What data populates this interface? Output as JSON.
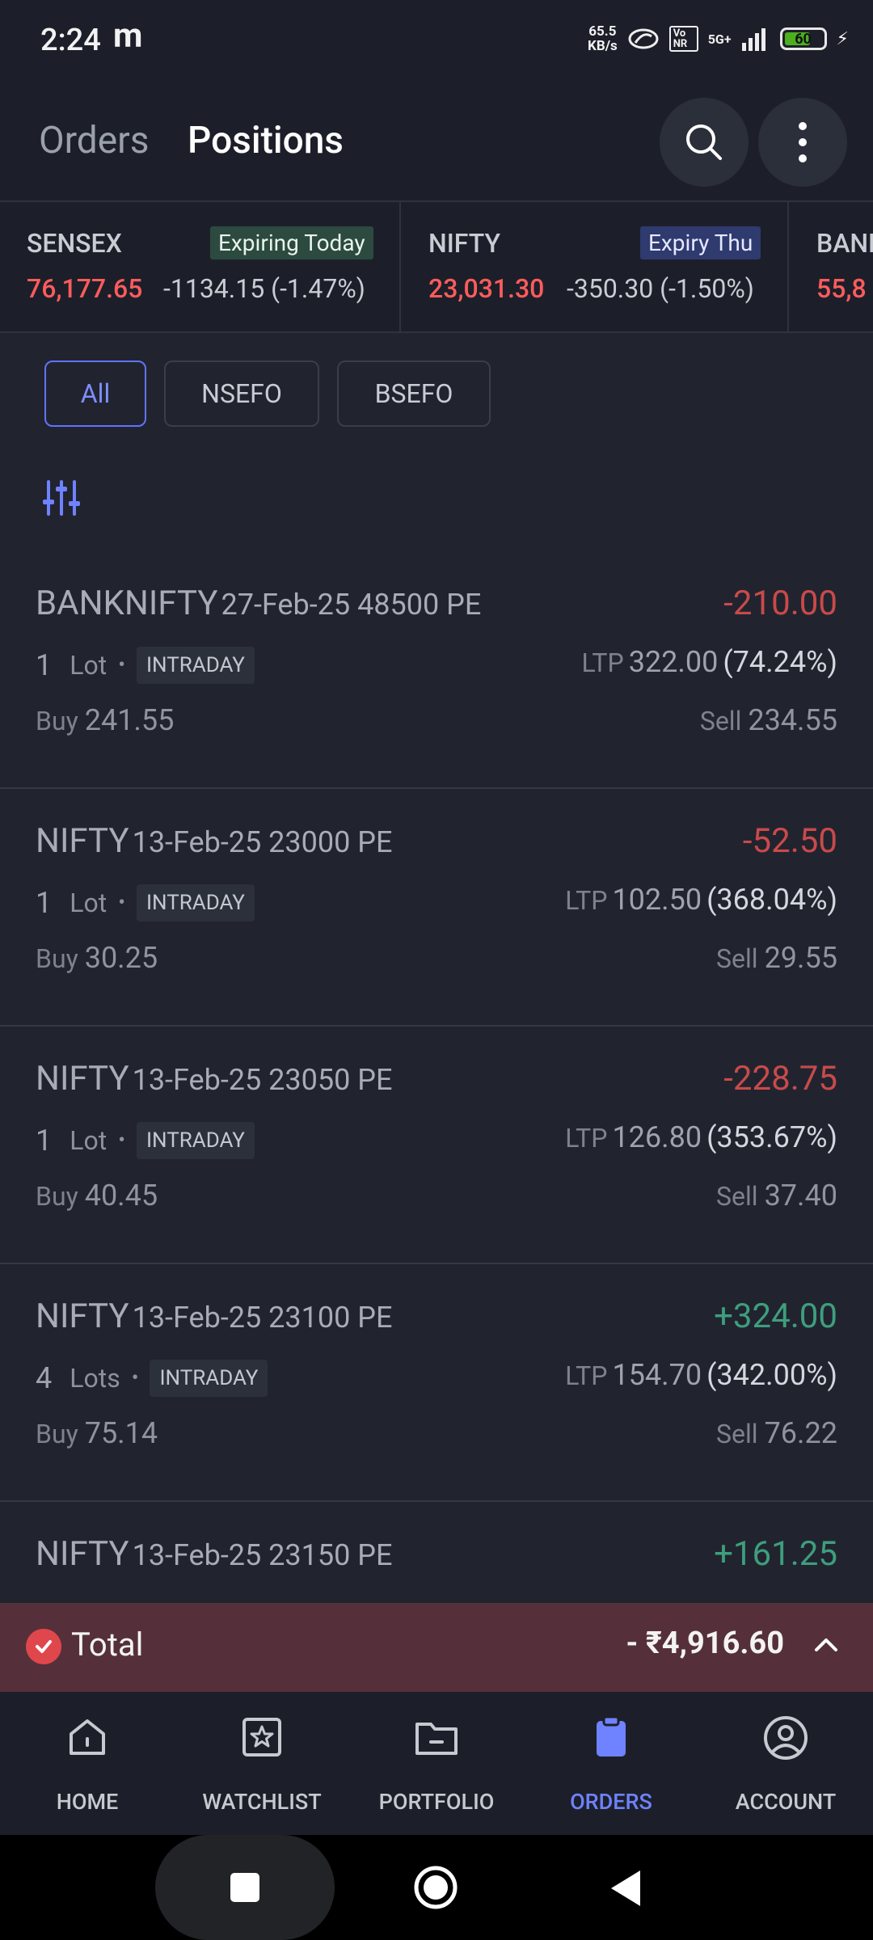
{
  "status_bar": {
    "time": "2:24",
    "app_glyph": "m",
    "net_speed_top": "65.5",
    "net_speed_bottom": "KB/s",
    "volte": "Vo NR",
    "signal": "5G+",
    "battery": "60"
  },
  "header": {
    "tab_orders": "Orders",
    "tab_positions": "Positions",
    "search_icon": "search-icon",
    "more_icon": "more-vertical-icon"
  },
  "indices": [
    {
      "name": "SENSEX",
      "badge": "Expiring Today",
      "price": "76,177.65",
      "change": "-1134.15 (-1.47%)"
    },
    {
      "name": "NIFTY",
      "badge": "Expiry Thu",
      "price": "23,031.30",
      "change": "-350.30 (-1.50%)"
    },
    {
      "name": "BANK",
      "price": "55,8"
    }
  ],
  "filters": [
    "All",
    "NSEFO",
    "BSEFO"
  ],
  "positions": [
    {
      "symbol": "BANKNIFTY",
      "desc": "27-Feb-25 48500 PE",
      "pnl": "-210.00",
      "qty": "1",
      "unit": "Lot",
      "product": "INTRADAY",
      "ltp_label": "LTP",
      "ltp": "322.00",
      "ltp_pct": "(74.24%)",
      "buy_label": "Buy",
      "buy": "241.55",
      "sell_label": "Sell",
      "sell": "234.55"
    },
    {
      "symbol": "NIFTY",
      "desc": "13-Feb-25 23000 PE",
      "pnl": "-52.50",
      "qty": "1",
      "unit": "Lot",
      "product": "INTRADAY",
      "ltp_label": "LTP",
      "ltp": "102.50",
      "ltp_pct": "(368.04%)",
      "buy_label": "Buy",
      "buy": "30.25",
      "sell_label": "Sell",
      "sell": "29.55"
    },
    {
      "symbol": "NIFTY",
      "desc": "13-Feb-25 23050 PE",
      "pnl": "-228.75",
      "qty": "1",
      "unit": "Lot",
      "product": "INTRADAY",
      "ltp_label": "LTP",
      "ltp": "126.80",
      "ltp_pct": "(353.67%)",
      "buy_label": "Buy",
      "buy": "40.45",
      "sell_label": "Sell",
      "sell": "37.40"
    },
    {
      "symbol": "NIFTY",
      "desc": "13-Feb-25 23100 PE",
      "pnl": "+324.00",
      "qty": "4",
      "unit": "Lots",
      "product": "INTRADAY",
      "ltp_label": "LTP",
      "ltp": "154.70",
      "ltp_pct": "(342.00%)",
      "buy_label": "Buy",
      "buy": "75.14",
      "sell_label": "Sell",
      "sell": "76.22"
    },
    {
      "symbol": "NIFTY",
      "desc": "13-Feb-25 23150 PE",
      "pnl": "+161.25"
    }
  ],
  "total": {
    "label": "Total",
    "value": "- ₹4,916.60"
  },
  "bottom_nav": [
    "HOME",
    "WATCHLIST",
    "PORTFOLIO",
    "ORDERS",
    "ACCOUNT"
  ],
  "colors": {
    "accent": "#6f82ff",
    "loss": "#c94a4a",
    "profit": "#3e9e7d",
    "index_red": "#ff5c5c",
    "total_bar": "#55303a"
  }
}
